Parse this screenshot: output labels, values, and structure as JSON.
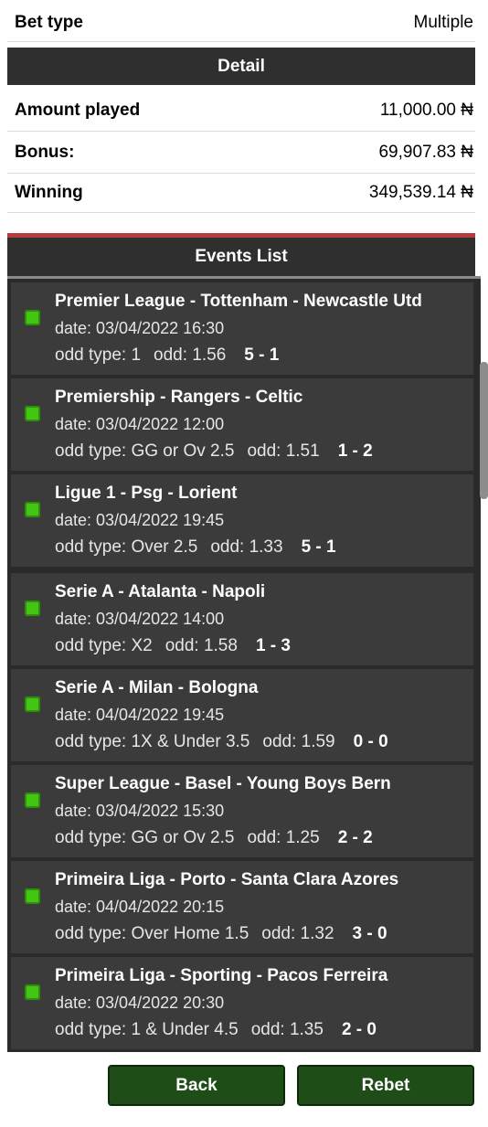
{
  "bet_type": {
    "label": "Bet type",
    "value": "Multiple"
  },
  "detail": {
    "header": "Detail",
    "rows": [
      {
        "label": "Amount played",
        "value": "11,000.00 ₦"
      },
      {
        "label": "Bonus:",
        "value": "69,907.83 ₦"
      },
      {
        "label": "Winning",
        "value": "349,539.14 ₦"
      }
    ]
  },
  "events": {
    "header": "Events List",
    "items": [
      {
        "title": "Premier League - Tottenham - Newcastle Utd",
        "date": "date: 03/04/2022 16:30",
        "odd_type": "odd type: 1",
        "odd": "odd: 1.56",
        "score": "5 - 1"
      },
      {
        "title": "Premiership - Rangers - Celtic",
        "date": "date: 03/04/2022 12:00",
        "odd_type": "odd type: GG or Ov 2.5",
        "odd": "odd: 1.51",
        "score": "1 - 2"
      },
      {
        "title": "Ligue 1 - Psg - Lorient",
        "date": "date: 03/04/2022 19:45",
        "odd_type": "odd type: Over 2.5",
        "odd": "odd: 1.33",
        "score": "5 - 1"
      },
      {
        "title": "Serie A - Atalanta - Napoli",
        "date": "date: 03/04/2022 14:00",
        "odd_type": "odd type: X2",
        "odd": "odd: 1.58",
        "score": "1 - 3"
      },
      {
        "title": "Serie A - Milan - Bologna",
        "date": "date: 04/04/2022 19:45",
        "odd_type": "odd type: 1X & Under 3.5",
        "odd": "odd: 1.59",
        "score": "0 - 0"
      },
      {
        "title": "Super League - Basel - Young Boys Bern",
        "date": "date: 03/04/2022 15:30",
        "odd_type": "odd type: GG or Ov 2.5",
        "odd": "odd: 1.25",
        "score": "2 - 2"
      },
      {
        "title": "Primeira Liga - Porto - Santa Clara Azores",
        "date": "date: 04/04/2022 20:15",
        "odd_type": "odd type: Over Home 1.5",
        "odd": "odd: 1.32",
        "score": "3 - 0"
      },
      {
        "title": "Primeira Liga - Sporting - Pacos Ferreira",
        "date": "date: 03/04/2022 20:30",
        "odd_type": "odd type: 1 & Under 4.5",
        "odd": "odd: 1.35",
        "score": "2 - 0"
      }
    ]
  },
  "buttons": {
    "back": "Back",
    "rebet": "Rebet"
  }
}
